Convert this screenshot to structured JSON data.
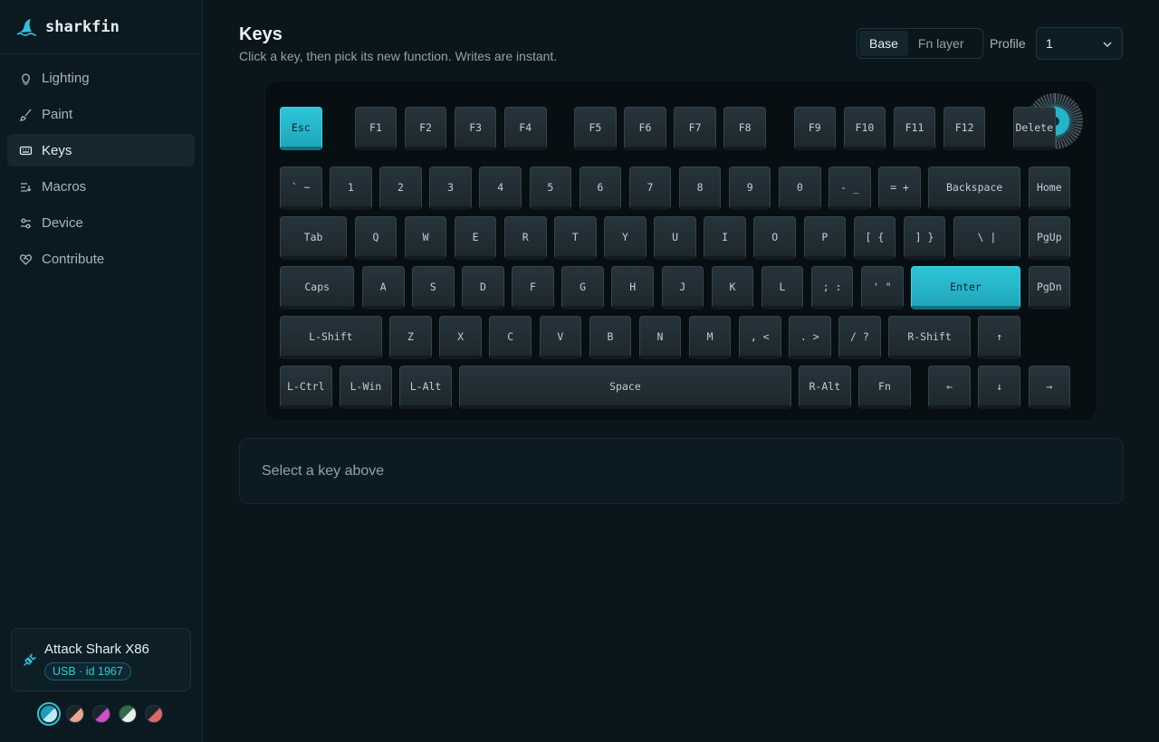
{
  "brand": {
    "name": "sharkfin"
  },
  "nav": [
    {
      "label": "Lighting",
      "icon": "lightbulb-icon",
      "active": false
    },
    {
      "label": "Paint",
      "icon": "brush-icon",
      "active": false
    },
    {
      "label": "Keys",
      "icon": "keyboard-icon",
      "active": true
    },
    {
      "label": "Macros",
      "icon": "macros-icon",
      "active": false
    },
    {
      "label": "Device",
      "icon": "sliders-icon",
      "active": false
    },
    {
      "label": "Contribute",
      "icon": "heart-handshake-icon",
      "active": false
    }
  ],
  "device": {
    "name": "Attack Shark X86",
    "connection": "USB · id 1967",
    "icon": "plug-icon"
  },
  "themes": [
    {
      "a": "#1c9fb8",
      "b": "#bfeaf1",
      "active": true
    },
    {
      "a": "#1b262c",
      "b": "#e9a58f",
      "active": false
    },
    {
      "a": "#1b262c",
      "b": "#d24dc8",
      "active": false
    },
    {
      "a": "#2f6b48",
      "b": "#e9efe9",
      "active": false
    },
    {
      "a": "#1b262c",
      "b": "#e06767",
      "active": false
    }
  ],
  "header": {
    "title": "Keys",
    "subtitle": "Click a key, then pick its new function. Writes are instant.",
    "layers": [
      {
        "label": "Base",
        "active": true
      },
      {
        "label": "Fn layer",
        "active": false
      }
    ],
    "profile_label": "Profile",
    "profile_value": "1"
  },
  "keyboard": {
    "rows": [
      [
        {
          "label": "Esc",
          "w": 1,
          "highlight": true
        },
        {
          "gap": 0.5
        },
        {
          "label": "F1",
          "w": 1
        },
        {
          "label": "F2",
          "w": 1
        },
        {
          "label": "F3",
          "w": 1
        },
        {
          "label": "F4",
          "w": 1
        },
        {
          "gap": 0.4
        },
        {
          "label": "F5",
          "w": 1
        },
        {
          "label": "F6",
          "w": 1
        },
        {
          "label": "F7",
          "w": 1
        },
        {
          "label": "F8",
          "w": 1
        },
        {
          "gap": 0.4
        },
        {
          "label": "F9",
          "w": 1
        },
        {
          "label": "F10",
          "w": 1
        },
        {
          "label": "F11",
          "w": 1
        },
        {
          "label": "F12",
          "w": 1
        },
        {
          "gap": 0.4
        },
        {
          "label": "Delete",
          "w": 1
        }
      ],
      [
        {
          "label": "` ~",
          "w": 1
        },
        {
          "label": "1",
          "w": 1
        },
        {
          "label": "2",
          "w": 1
        },
        {
          "label": "3",
          "w": 1
        },
        {
          "label": "4",
          "w": 1
        },
        {
          "label": "5",
          "w": 1
        },
        {
          "label": "6",
          "w": 1
        },
        {
          "label": "7",
          "w": 1
        },
        {
          "label": "8",
          "w": 1
        },
        {
          "label": "9",
          "w": 1
        },
        {
          "label": "0",
          "w": 1
        },
        {
          "label": "- _",
          "w": 1
        },
        {
          "label": "= +",
          "w": 1
        },
        {
          "label": "Backspace",
          "w": 2
        },
        {
          "label": "Home",
          "w": 1
        }
      ],
      [
        {
          "label": "Tab",
          "w": 1.5
        },
        {
          "label": "Q",
          "w": 1
        },
        {
          "label": "W",
          "w": 1
        },
        {
          "label": "E",
          "w": 1
        },
        {
          "label": "R",
          "w": 1
        },
        {
          "label": "T",
          "w": 1
        },
        {
          "label": "Y",
          "w": 1
        },
        {
          "label": "U",
          "w": 1
        },
        {
          "label": "I",
          "w": 1
        },
        {
          "label": "O",
          "w": 1
        },
        {
          "label": "P",
          "w": 1
        },
        {
          "label": "[ {",
          "w": 1
        },
        {
          "label": "] }",
          "w": 1
        },
        {
          "label": "\\ |",
          "w": 1.5
        },
        {
          "label": "PgUp",
          "w": 1
        }
      ],
      [
        {
          "label": "Caps",
          "w": 1.65
        },
        {
          "label": "A",
          "w": 1
        },
        {
          "label": "S",
          "w": 1
        },
        {
          "label": "D",
          "w": 1
        },
        {
          "label": "F",
          "w": 1
        },
        {
          "label": "G",
          "w": 1
        },
        {
          "label": "H",
          "w": 1
        },
        {
          "label": "J",
          "w": 1
        },
        {
          "label": "K",
          "w": 1
        },
        {
          "label": "L",
          "w": 1
        },
        {
          "label": "; :",
          "w": 1
        },
        {
          "label": "' \"",
          "w": 1
        },
        {
          "label": "Enter",
          "w": 2.35,
          "highlight": true
        },
        {
          "label": "PgDn",
          "w": 1
        }
      ],
      [
        {
          "label": "L-Shift",
          "w": 2.2
        },
        {
          "label": "Z",
          "w": 1
        },
        {
          "label": "X",
          "w": 1
        },
        {
          "label": "C",
          "w": 1
        },
        {
          "label": "V",
          "w": 1
        },
        {
          "label": "B",
          "w": 1
        },
        {
          "label": "N",
          "w": 1
        },
        {
          "label": "M",
          "w": 1
        },
        {
          "label": ", <",
          "w": 1
        },
        {
          "label": ". >",
          "w": 1
        },
        {
          "label": "/ ?",
          "w": 1
        },
        {
          "label": "R-Shift",
          "w": 1.8
        },
        {
          "label": "↑",
          "w": 1
        }
      ],
      [
        {
          "label": "L-Ctrl",
          "w": 1.2
        },
        {
          "label": "L-Win",
          "w": 1.2
        },
        {
          "label": "L-Alt",
          "w": 1.2
        },
        {
          "label": "Space",
          "w": 6.8
        },
        {
          "label": "R-Alt",
          "w": 1.2
        },
        {
          "label": "Fn",
          "w": 1.2
        },
        {
          "gap": 0.2
        },
        {
          "label": "←",
          "w": 1
        },
        {
          "label": "↓",
          "w": 1
        },
        {
          "label": "→",
          "w": 1
        }
      ]
    ]
  },
  "selection": {
    "empty_text": "Select a key above"
  }
}
